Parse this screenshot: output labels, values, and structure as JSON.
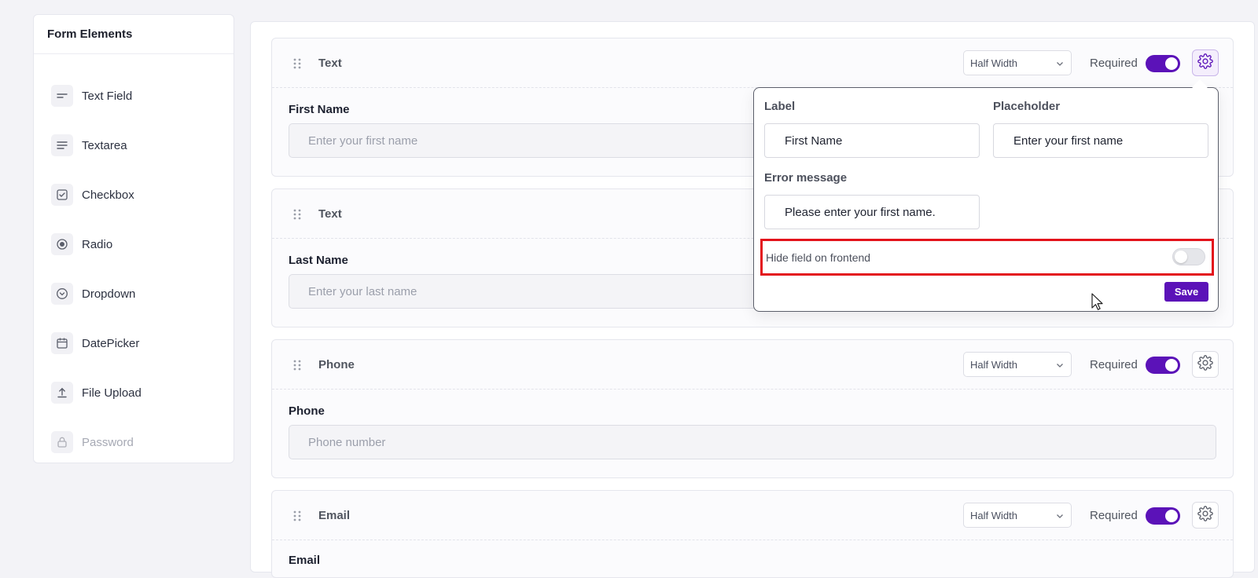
{
  "colors": {
    "accent": "#5b12b8",
    "highlight": "#e3131b"
  },
  "sidebar": {
    "title": "Form Elements",
    "items": [
      {
        "label": "Text Field",
        "icon": "text-field-icon"
      },
      {
        "label": "Textarea",
        "icon": "textarea-icon"
      },
      {
        "label": "Checkbox",
        "icon": "checkbox-icon"
      },
      {
        "label": "Radio",
        "icon": "radio-icon"
      },
      {
        "label": "Dropdown",
        "icon": "dropdown-icon"
      },
      {
        "label": "DatePicker",
        "icon": "calendar-icon"
      },
      {
        "label": "File Upload",
        "icon": "upload-icon"
      },
      {
        "label": "Password",
        "icon": "lock-icon",
        "disabled": true
      }
    ]
  },
  "fields": [
    {
      "type": "Text",
      "width": "Half Width",
      "required_label": "Required",
      "required": true,
      "label": "First Name",
      "placeholder": "Enter your first name"
    },
    {
      "type": "Text",
      "label": "Last Name",
      "placeholder": "Enter your last name"
    },
    {
      "type": "Phone",
      "width": "Half Width",
      "required_label": "Required",
      "required": true,
      "label": "Phone",
      "placeholder": "Phone number"
    },
    {
      "type": "Email",
      "width": "Half Width",
      "required_label": "Required",
      "required": true,
      "label": "Email"
    }
  ],
  "popover": {
    "label_heading": "Label",
    "label_value": "First Name",
    "placeholder_heading": "Placeholder",
    "placeholder_value": "Enter your first name",
    "error_heading": "Error message",
    "error_value": "Please enter your first name.",
    "hide_label": "Hide field on frontend",
    "hide_enabled": false,
    "save_label": "Save"
  }
}
